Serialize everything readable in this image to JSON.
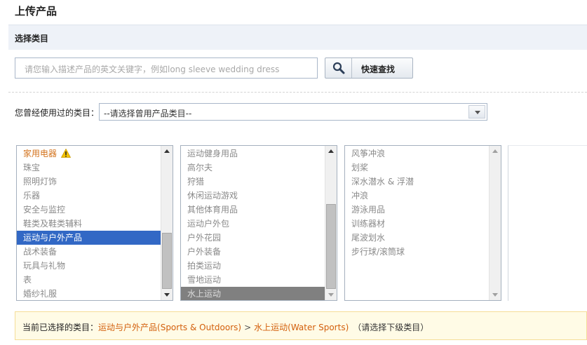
{
  "page": {
    "title": "上传产品"
  },
  "section": {
    "title": "选择类目"
  },
  "search": {
    "placeholder": "请您输入描述产品的英文关键字，例如long sleeve wedding dress",
    "button_label": "快速查找",
    "icon": "search-icon"
  },
  "used_category": {
    "label": "您曾经使用过的类目：",
    "selected": "--请选择曾用产品类目--"
  },
  "category_level1": {
    "items": [
      {
        "label": "家用电器",
        "warning": true
      },
      {
        "label": "珠宝"
      },
      {
        "label": "照明灯饰"
      },
      {
        "label": "乐器"
      },
      {
        "label": "安全与监控"
      },
      {
        "label": "鞋类及鞋类辅料"
      },
      {
        "label": "运动与户外产品",
        "selected": true
      },
      {
        "label": "战术装备"
      },
      {
        "label": "玩具与礼物"
      },
      {
        "label": "表"
      },
      {
        "label": "婚纱礼服"
      }
    ]
  },
  "category_level2": {
    "items": [
      {
        "label": "运动健身用品"
      },
      {
        "label": "高尔夫"
      },
      {
        "label": "狩猎"
      },
      {
        "label": "休闲运动游戏"
      },
      {
        "label": "其他体育用品"
      },
      {
        "label": "运动户外包"
      },
      {
        "label": "户外花园"
      },
      {
        "label": "户外装备"
      },
      {
        "label": "拍类运动"
      },
      {
        "label": "雪地运动"
      },
      {
        "label": "水上运动",
        "selected": true
      }
    ]
  },
  "category_level3": {
    "items": [
      {
        "label": "风筝冲浪"
      },
      {
        "label": "划桨"
      },
      {
        "label": "深水潜水 & 浮潜"
      },
      {
        "label": "冲浪"
      },
      {
        "label": "游泳用品"
      },
      {
        "label": "训练器材"
      },
      {
        "label": "尾波划水"
      },
      {
        "label": "步行球/滚筒球"
      }
    ]
  },
  "current_selection": {
    "label": "当前已选择的类目：",
    "level1": "运动与户外产品(Sports & Outdoors)",
    "separator": ">",
    "level2": "水上运动(Water Sports)",
    "hint": "（请选择下级类目）"
  },
  "colors": {
    "accent_blue": "#3268c5",
    "path_orange": "#d35f0c",
    "warning_orange": "#d3731d",
    "notice_bg": "#fffbe6"
  }
}
